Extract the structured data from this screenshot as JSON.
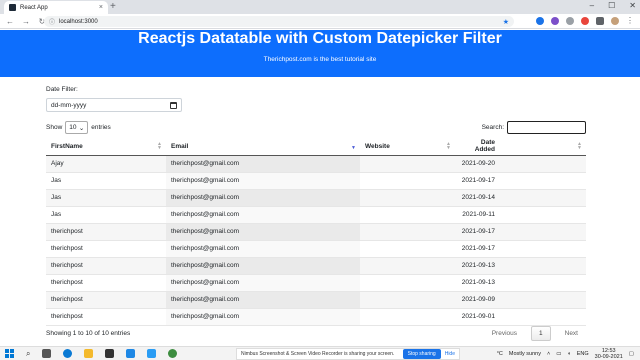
{
  "browser": {
    "tab_title": "React App",
    "tab_close": "×",
    "new_tab": "+",
    "url": "localhost:3000",
    "window_buttons": [
      "–",
      "☐",
      "✕"
    ]
  },
  "header": {
    "title": "Reactjs Datatable with Custom Datepicker Filter",
    "subtitle": "Therichpost.com is the best tutorial site",
    "bg_color": "#0d6efd"
  },
  "filter": {
    "label": "Date Filter:",
    "placeholder": "dd-mm-yyyy",
    "icon": "calendar-icon"
  },
  "length": {
    "show_label": "Show",
    "selected": "10",
    "entries_label": "entries"
  },
  "search": {
    "label": "Search:",
    "value": ""
  },
  "table": {
    "columns": [
      "FirstName",
      "Email",
      "Website",
      "Date Added"
    ],
    "rows": [
      [
        "Ajay",
        "therichpost@gmail.com",
        "",
        "2021-09-20"
      ],
      [
        "Jas",
        "therichpost@gmail.com",
        "",
        "2021-09-17"
      ],
      [
        "Jas",
        "therichpost@gmail.com",
        "",
        "2021-09-14"
      ],
      [
        "Jas",
        "therichpost@gmail.com",
        "",
        "2021-09-11"
      ],
      [
        "therichpost",
        "therichpost@gmail.com",
        "",
        "2021-09-17"
      ],
      [
        "therichpost",
        "therichpost@gmail.com",
        "",
        "2021-09-17"
      ],
      [
        "therichpost",
        "therichpost@gmail.com",
        "",
        "2021-09-13"
      ],
      [
        "therichpost",
        "therichpost@gmail.com",
        "",
        "2021-09-13"
      ],
      [
        "therichpost",
        "therichpost@gmail.com",
        "",
        "2021-09-09"
      ],
      [
        "therichpost",
        "therichpost@gmail.com",
        "",
        "2021-09-01"
      ]
    ]
  },
  "info": "Showing 1 to 10 of 10 entries",
  "pagination": {
    "previous": "Previous",
    "current": "1",
    "next": "Next"
  },
  "taskbar": {
    "share_message": "Nimbus Screenshot & Screen Video Recorder is sharing your screen.",
    "stop_sharing": "Stop sharing",
    "hide": "Hide",
    "weather": "Mostly sunny",
    "temperature": "°C",
    "language": "ENG",
    "time": "12:53",
    "date": "30-09-2021"
  }
}
